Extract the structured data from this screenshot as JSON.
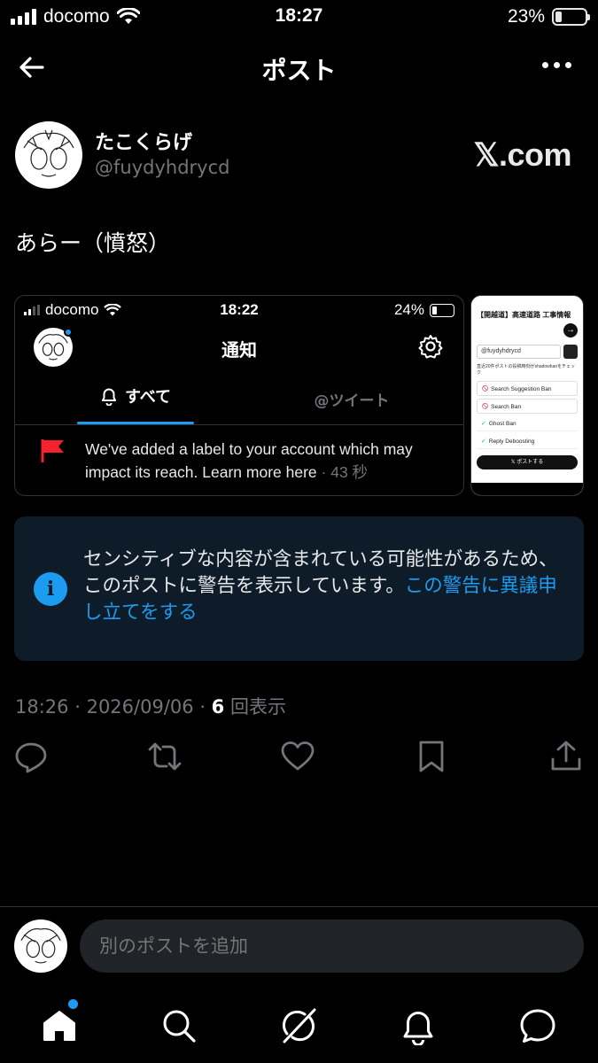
{
  "status_bar": {
    "carrier": "docomo",
    "time": "18:27",
    "battery": "23%",
    "battery_level": 0.23
  },
  "header": {
    "title": "ポスト"
  },
  "author": {
    "name": "たこくらげ",
    "handle": "@fuydyhdrycd",
    "watermark": "𝕏.com"
  },
  "post": {
    "text": "あらー（憤怒）"
  },
  "media_main": {
    "carrier": "docomo",
    "time": "18:22",
    "battery": "24%",
    "title": "通知",
    "tab_all": "すべて",
    "tab_tweets": "@ツイート",
    "notice": "We've added a label to your account which may impact its reach. Learn more here",
    "notice_age": "· 43 秒"
  },
  "media_side": {
    "header": "【開越道】高速道路 工事情報",
    "search_value": "@fuydyhdrycd",
    "check_text": "直近20件ポストの投稿時刻がshadowbanをチェック",
    "rows": [
      {
        "mark": "🛇",
        "label": "Search Suggestion Ban"
      },
      {
        "mark": "🛇",
        "label": "Search Ban"
      },
      {
        "mark": "✓",
        "label": "Ghost Ban"
      },
      {
        "mark": "✓",
        "label": "Reply Deboosting"
      }
    ],
    "post_button": "𝕏 ポストする"
  },
  "warning": {
    "text": "センシティブな内容が含まれている可能性があるため、このポストに警告を表示しています。",
    "link": "この警告に異議申し立てをする"
  },
  "meta": {
    "time": "18:26",
    "date": "2026/09/06",
    "views": "6",
    "views_label": "回表示"
  },
  "reply": {
    "placeholder": "別のポストを追加"
  },
  "colors": {
    "accent": "#1d9bf0",
    "background": "#000000",
    "muted": "#71767b",
    "warning_bg": "#0d1c28",
    "flag": "#f4212e"
  }
}
